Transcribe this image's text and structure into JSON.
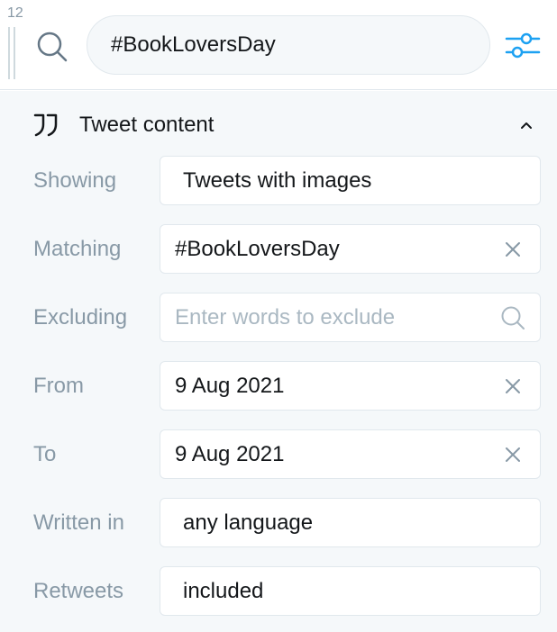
{
  "header": {
    "column_number": "12",
    "search_value": "#BookLoversDay"
  },
  "section": {
    "title": "Tweet content"
  },
  "rows": {
    "showing": {
      "label": "Showing",
      "value": "Tweets with images"
    },
    "matching": {
      "label": "Matching",
      "value": "#BookLoversDay"
    },
    "excluding": {
      "label": "Excluding",
      "placeholder": "Enter words to exclude"
    },
    "from": {
      "label": "From",
      "value": "9 Aug 2021"
    },
    "to": {
      "label": "To",
      "value": "9 Aug 2021"
    },
    "written_in": {
      "label": "Written in",
      "value": "any language"
    },
    "retweets": {
      "label": "Retweets",
      "value": "included"
    }
  },
  "colors": {
    "accent": "#1da1f2",
    "label": "#8899a6",
    "border": "#e1e8ed",
    "panel_bg": "#f5f8fa"
  },
  "icons": [
    "search-icon",
    "filter-sliders-icon",
    "quote-icon",
    "chevron-up-icon",
    "clear-icon"
  ]
}
